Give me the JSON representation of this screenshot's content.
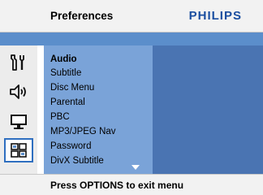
{
  "header": {
    "title": "Preferences",
    "brand": "PHILIPS"
  },
  "sidebar_icons": [
    {
      "name": "settings-wrench-icon",
      "selected": false
    },
    {
      "name": "speaker-icon",
      "selected": false
    },
    {
      "name": "tv-monitor-icon",
      "selected": false
    },
    {
      "name": "preferences-grid-icon",
      "selected": true
    }
  ],
  "menu": {
    "items": [
      {
        "label": "Audio",
        "active": true
      },
      {
        "label": "Subtitle",
        "active": false
      },
      {
        "label": "Disc Menu",
        "active": false
      },
      {
        "label": "Parental",
        "active": false
      },
      {
        "label": "PBC",
        "active": false
      },
      {
        "label": "MP3/JPEG Nav",
        "active": false
      },
      {
        "label": "Password",
        "active": false
      },
      {
        "label": "DivX Subtitle",
        "active": false
      }
    ],
    "has_more": true
  },
  "footer": {
    "hint": "Press OPTIONS to exit menu"
  },
  "colors": {
    "accent_blue": "#5b8ecb",
    "menu_blue": "#7aa3d8",
    "panel_blue": "#4a74b2",
    "brand_blue": "#1a4ea0"
  }
}
